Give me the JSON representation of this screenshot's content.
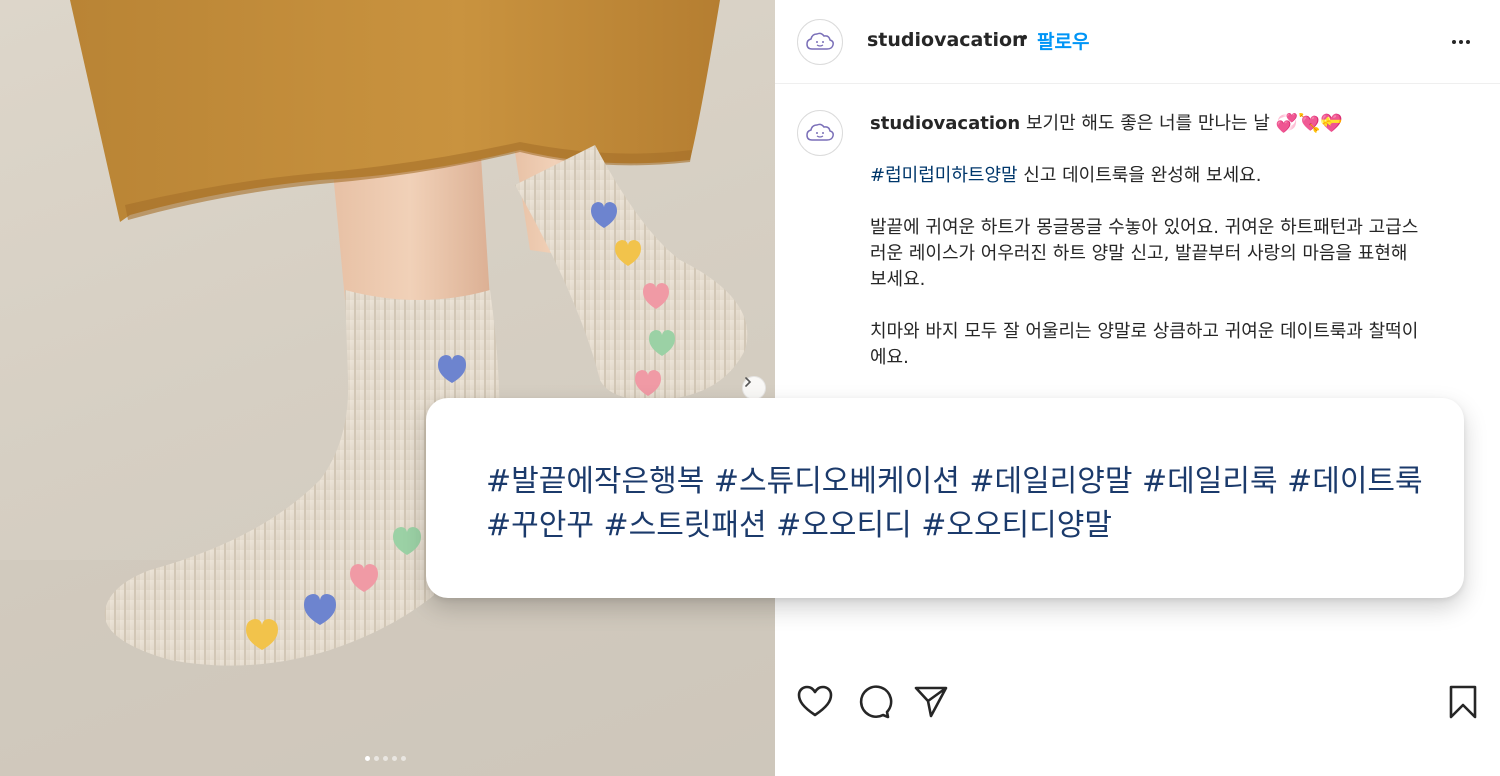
{
  "post": {
    "username": "studiovacation",
    "separator": "•",
    "follow_label": "팔로우",
    "more_icon": "more-horizontal-icon"
  },
  "caption": {
    "username": "studiovacation",
    "line1_text": "보기만 해도 좋은 너를 만나는 날",
    "emojis": "💞💘💝",
    "hashtag": "#럽미럽미하트양말",
    "hashtag_rest": " 신고 데이트룩을 완성해 보세요.",
    "para2_a": "발끝에 귀여운 하트가 몽글몽글 수놓아 있어요. 귀여운 하트패턴과 고급스",
    "para2_b": "러운 레이스가 어우러진 하트 양말 신고, 발끝부터 사랑의 마음을 표현해",
    "para2_c": "보세요.",
    "para3_a": "치마와 바지 모두 잘 어울리는 양말로 상큼하고 귀여운 데이트룩과 찰떡이",
    "para3_b": "에요."
  },
  "hashtag_card": {
    "line1": "#발끝에작은행복 #스튜디오베케이션 #데일리양말 #데일리룩 #데이트룩",
    "line2": "#꾸안꾸 #스트릿패션 #오오티디 #오오티디양말"
  },
  "carousel": {
    "total_slides": 5,
    "current_slide": 1
  },
  "actions": [
    "heart-icon",
    "comment-icon",
    "share-icon",
    "bookmark-icon"
  ],
  "colors": {
    "link_blue": "#0095f6",
    "hashtag_navy": "#00376b",
    "text": "#262626"
  }
}
